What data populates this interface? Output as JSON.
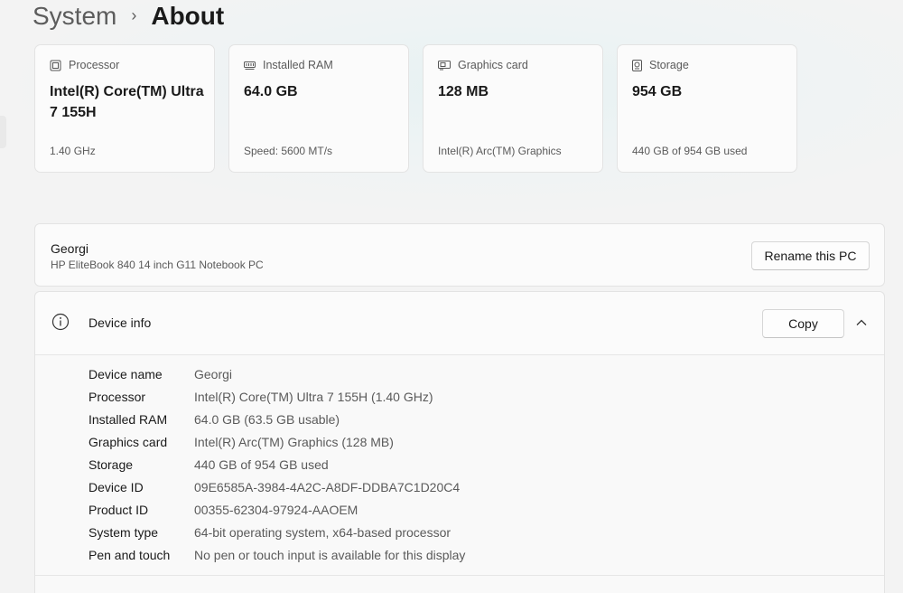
{
  "breadcrumb": {
    "parent": "System",
    "separator": "›",
    "current": "About"
  },
  "spec_cards": [
    {
      "icon": "processor-icon",
      "title": "Processor",
      "value": "Intel(R) Core(TM) Ultra 7 155H",
      "detail": "1.40 GHz"
    },
    {
      "icon": "ram-icon",
      "title": "Installed RAM",
      "value": "64.0 GB",
      "detail": "Speed: 5600 MT/s"
    },
    {
      "icon": "graphics-card-icon",
      "title": "Graphics card",
      "value": "128 MB",
      "detail": "Intel(R) Arc(TM) Graphics"
    },
    {
      "icon": "storage-icon",
      "title": "Storage",
      "value": "954 GB",
      "detail": "440 GB of 954 GB used"
    }
  ],
  "pc": {
    "name": "Georgi",
    "model": "HP EliteBook 840 14 inch G11 Notebook PC",
    "rename_label": "Rename this PC"
  },
  "device_info": {
    "icon": "info-icon",
    "title": "Device info",
    "copy_label": "Copy",
    "expanded": true,
    "rows": [
      {
        "label": "Device name",
        "value": "Georgi"
      },
      {
        "label": "Processor",
        "value": "Intel(R) Core(TM) Ultra 7 155H (1.40 GHz)"
      },
      {
        "label": "Installed RAM",
        "value": "64.0 GB (63.5 GB usable)"
      },
      {
        "label": "Graphics card",
        "value": "Intel(R) Arc(TM) Graphics (128 MB)"
      },
      {
        "label": "Storage",
        "value": "440 GB of 954 GB used"
      },
      {
        "label": "Device ID",
        "value": "09E6585A-3984-4A2C-A8DF-DDBA7C1D20C4"
      },
      {
        "label": "Product ID",
        "value": "00355-62304-97924-AAOEM"
      },
      {
        "label": "System type",
        "value": "64-bit operating system, x64-based processor"
      },
      {
        "label": "Pen and touch",
        "value": "No pen or touch input is available for this display"
      }
    ]
  }
}
